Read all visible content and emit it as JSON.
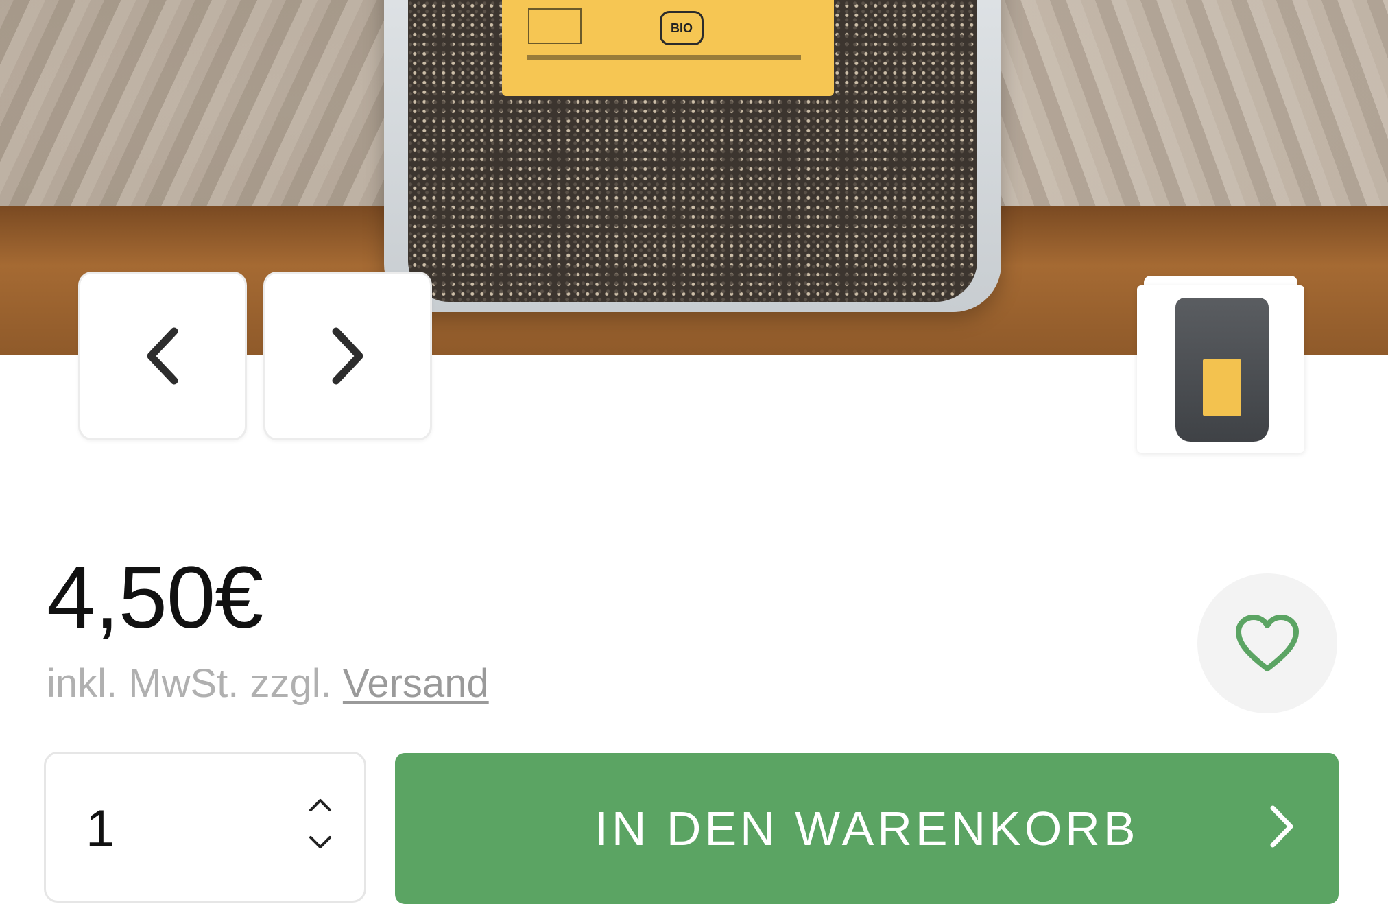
{
  "product": {
    "price": "4,50€",
    "tax_prefix": "inkl. MwSt. zzgl.",
    "shipping_link": "Versand",
    "label_bio": "BIO"
  },
  "gallery": {
    "prev_icon": "chevron-left-icon",
    "next_icon": "chevron-right-icon"
  },
  "quantity": {
    "value": "1"
  },
  "actions": {
    "add_to_cart_label": "IN DEN WARENKORB",
    "wishlist_icon": "heart-icon"
  },
  "colors": {
    "brand_green": "#5ba463",
    "heart_green": "#5ba463",
    "icon_dark": "#2d2d2d"
  }
}
